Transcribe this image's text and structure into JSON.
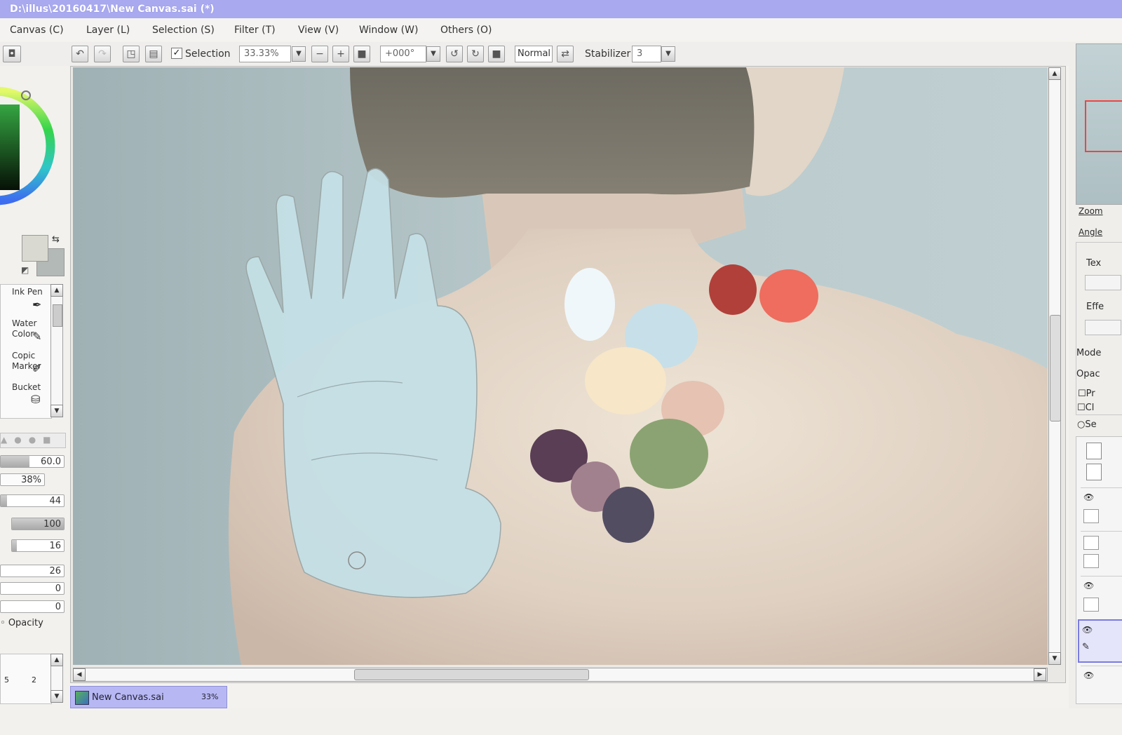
{
  "window": {
    "title": "D:\\illus\\20160417\\New Canvas.sai (*)"
  },
  "menu": [
    {
      "label": "Canvas (C)"
    },
    {
      "label": "Layer (L)"
    },
    {
      "label": "Selection (S)"
    },
    {
      "label": "Filter (T)"
    },
    {
      "label": "View (V)"
    },
    {
      "label": "Window (W)"
    },
    {
      "label": "Others (O)"
    }
  ],
  "toolbar": {
    "selection_label": "Selection",
    "selection_checked": true,
    "zoom": "33.33%",
    "angle": "+000°",
    "blend_mode": "Normal",
    "stabilizer_label": "Stabilizer",
    "stabilizer_value": "3"
  },
  "brushes": [
    {
      "label": "Ink Pen"
    },
    {
      "label": "Water Color"
    },
    {
      "label": "Copic Marker"
    },
    {
      "label": "Bucket"
    }
  ],
  "brush_settings": {
    "size_value": "60.0",
    "size_fraction": 0.45,
    "min_size": "38%",
    "density": "44",
    "density_fraction": 0.1,
    "blending": "100",
    "blending_fraction": 1.0,
    "dilution": "16",
    "dilution_fraction": 0.1,
    "persistence": "26",
    "val_6": "0",
    "val_7": "0",
    "opacity_label": "Opacity",
    "list_values": [
      "5",
      "2"
    ]
  },
  "right_panel": {
    "zoom_label": "Zoom",
    "angle_label": "Angle",
    "texture_label": "Tex",
    "effect_label": "Effe",
    "mode_label": "Mode",
    "opacity_label": "Opac",
    "check_1": "Pr",
    "check_2": "Cl",
    "check_3": "Se"
  },
  "file_tab": {
    "name": "New Canvas.sai",
    "zoom": "33%"
  },
  "colors": {
    "titlebar": "#a9a9f0",
    "primary_color": "#dad9d1",
    "secondary_color": "#b3b9b6",
    "palette_swatches": [
      "#f0f7fb",
      "#c7dfe8",
      "#f7e6c8",
      "#e5c2b2",
      "#b1403a",
      "#ee6d5e",
      "#8ba372",
      "#5a3e55",
      "#a2818e",
      "#534d62"
    ]
  }
}
